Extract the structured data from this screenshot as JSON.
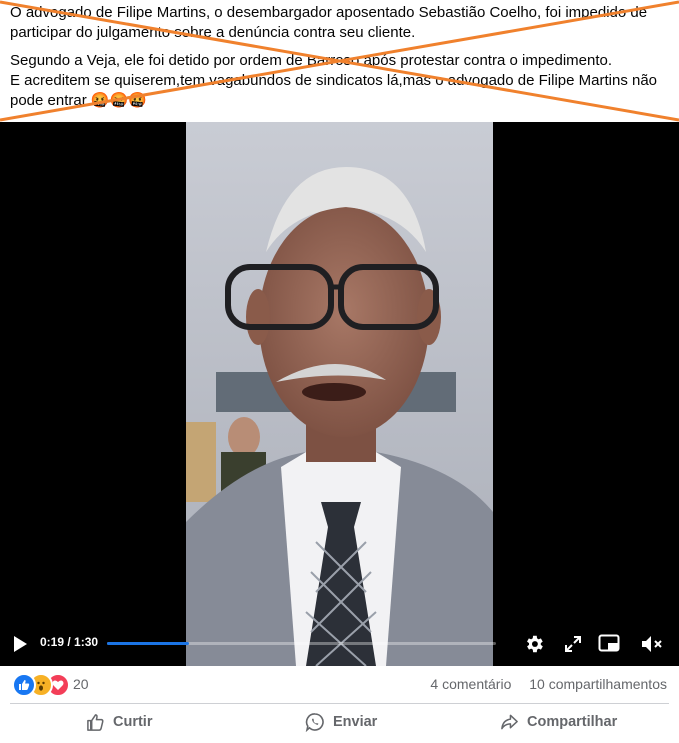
{
  "post": {
    "paragraph1": "O advogado de Filipe Martins, o desembargador aposentado Sebastião Coelho, foi impedido de participar do julgamento sobre a denúncia contra seu cliente.",
    "paragraph2_line1": "Segundo a Veja, ele foi detido por ordem de Barroso após protestar contra o impedimento.",
    "paragraph2_line2": "E acreditem se quiserem,tem vagabundos de sindicatos lá,mas o advogado de Filipe Martins não pode entrar",
    "emojis": "🤬🤬🤬",
    "strike_color": "#f0812d"
  },
  "video": {
    "time_label": "0:19 / 1:30",
    "progress": 0.2111,
    "accent": "#1b74e4",
    "icons": [
      "play-icon",
      "settings-icon",
      "fullscreen-icon",
      "pip-icon",
      "muted-icon"
    ]
  },
  "reactions": {
    "count": "20",
    "icons": [
      "like-icon",
      "wow-icon",
      "love-icon"
    ],
    "comments": "4 comentário",
    "shares": "10 compartilhamentos"
  },
  "actions": {
    "like": "Curtir",
    "send": "Enviar",
    "share": "Compartilhar"
  }
}
